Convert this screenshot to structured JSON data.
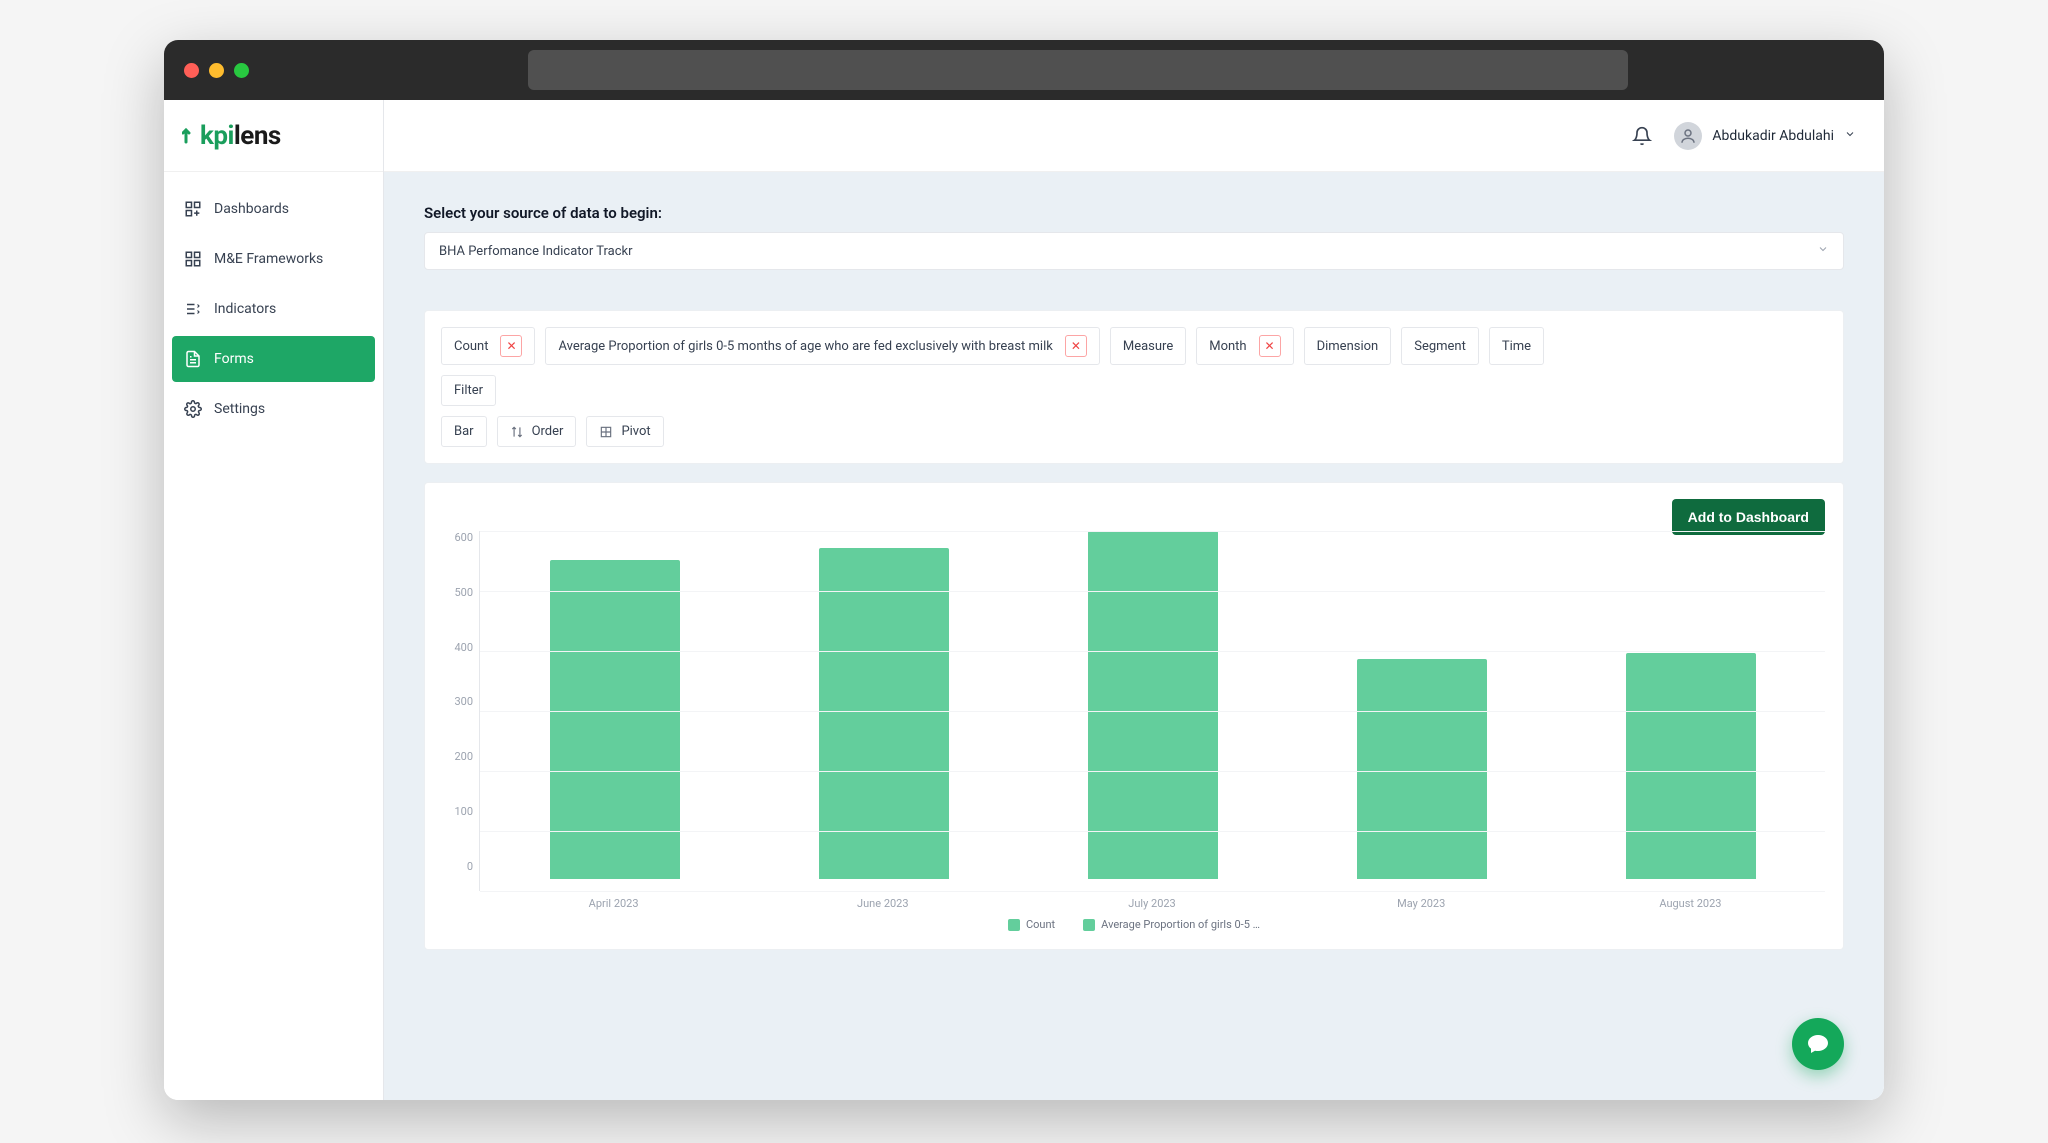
{
  "brand": {
    "prefix": "kpi",
    "suffix": "lens"
  },
  "user": {
    "name": "Abdukadir Abdulahi"
  },
  "sidebar": {
    "items": [
      {
        "label": "Dashboards"
      },
      {
        "label": "M&E Frameworks"
      },
      {
        "label": "Indicators"
      },
      {
        "label": "Forms"
      },
      {
        "label": "Settings"
      }
    ],
    "active_index": 3
  },
  "source": {
    "label": "Select your source of data to begin:",
    "selected": "BHA Perfomance Indicator Trackr"
  },
  "filters": {
    "row1": [
      {
        "label": "Count",
        "removable": true
      },
      {
        "label": "Average Proportion of girls 0-5 months of age who are fed exclusively with breast milk",
        "removable": true
      },
      {
        "label": "Measure",
        "removable": false
      },
      {
        "label": "Month",
        "removable": true
      },
      {
        "label": "Dimension",
        "removable": false
      },
      {
        "label": "Segment",
        "removable": false
      },
      {
        "label": "Time",
        "removable": false
      }
    ],
    "row2": [
      {
        "label": "Filter",
        "removable": false
      }
    ],
    "row3": [
      {
        "label": "Bar",
        "removable": false
      },
      {
        "label": "Order",
        "removable": false,
        "icon": "sort"
      },
      {
        "label": "Pivot",
        "removable": false,
        "icon": "grid"
      }
    ]
  },
  "actions": {
    "add_to_dashboard": "Add to Dashboard"
  },
  "chart_data": {
    "type": "bar",
    "categories": [
      "April 2023",
      "June 2023",
      "July 2023",
      "May 2023",
      "August 2023"
    ],
    "values": [
      550,
      570,
      600,
      380,
      390
    ],
    "series": [
      {
        "name": "Count",
        "values": [
          550,
          570,
          600,
          380,
          390
        ]
      },
      {
        "name": "Average Proportion of girls 0-5 …",
        "values": [
          550,
          570,
          600,
          380,
          390
        ]
      }
    ],
    "ylabel": "",
    "xlabel": "",
    "ylim": [
      0,
      600
    ],
    "y_ticks": [
      600,
      500,
      400,
      300,
      200,
      100,
      0
    ],
    "legend": [
      "Count",
      "Average Proportion of girls 0-5 …"
    ],
    "bar_color": "#63ce9c"
  }
}
